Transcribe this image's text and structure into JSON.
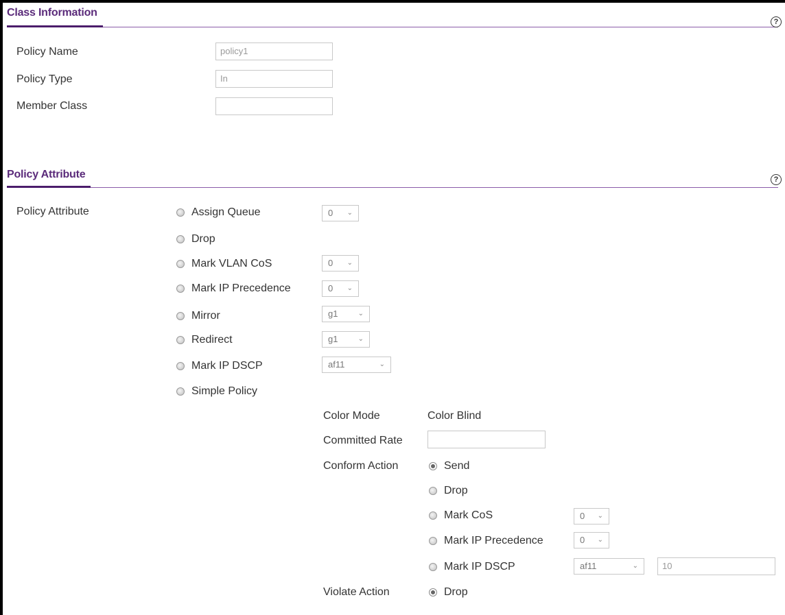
{
  "class_info": {
    "title": "Class Information",
    "help_icon": "?",
    "policy_name_label": "Policy Name",
    "policy_name_value": "policy1",
    "policy_type_label": "Policy Type",
    "policy_type_value": "In",
    "member_class_label": "Member Class",
    "member_class_value": ""
  },
  "policy_attr": {
    "title": "Policy Attribute",
    "help_icon": "?",
    "row_label": "Policy Attribute",
    "options": {
      "assign_queue": {
        "label": "Assign Queue",
        "value": "0"
      },
      "drop": {
        "label": "Drop"
      },
      "mark_vlan_cos": {
        "label": "Mark VLAN CoS",
        "value": "0"
      },
      "mark_ip_precedence": {
        "label": "Mark IP Precedence",
        "value": "0"
      },
      "mirror": {
        "label": "Mirror",
        "value": "g1"
      },
      "redirect": {
        "label": "Redirect",
        "value": "g1"
      },
      "mark_ip_dscp": {
        "label": "Mark IP DSCP",
        "value": "af11"
      },
      "simple_policy": {
        "label": "Simple Policy"
      }
    },
    "simple_policy": {
      "color_mode_label": "Color Mode",
      "color_mode_value": "Color Blind",
      "committed_rate_label": "Committed Rate",
      "committed_rate_value": "",
      "conform_action_label": "Conform Action",
      "conform": {
        "send": {
          "label": "Send",
          "selected": true
        },
        "drop": {
          "label": "Drop"
        },
        "mark_cos": {
          "label": "Mark CoS",
          "value": "0"
        },
        "mark_ip_precedence": {
          "label": "Mark IP Precedence",
          "value": "0"
        },
        "mark_ip_dscp": {
          "label": "Mark IP DSCP",
          "value": "af11",
          "extra_value": "10"
        }
      },
      "violate_action_label": "Violate Action",
      "violate": {
        "drop": {
          "label": "Drop",
          "selected": true
        }
      }
    }
  },
  "colors": {
    "section_title": "#5a2a7a",
    "section_line": "#8a5ba8",
    "section_underline": "#4b1c6b"
  }
}
